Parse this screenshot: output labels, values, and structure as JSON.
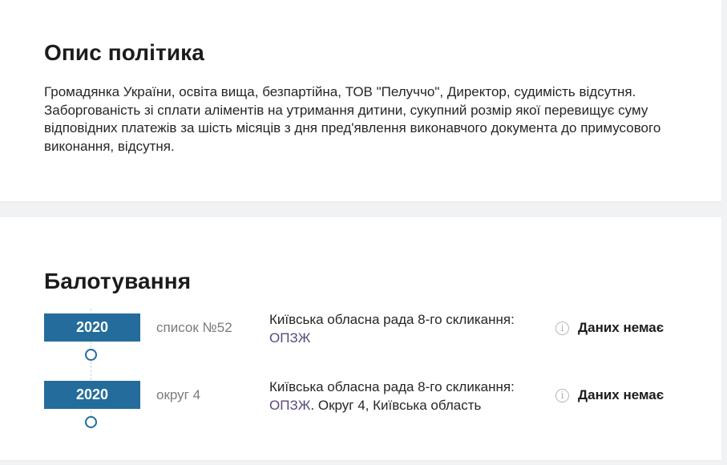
{
  "description": {
    "heading": "Опис політика",
    "text": "Громадянка України, освіта вища, безпартійна, ТОВ \"Пелуччо\", Директор, судимість відсутня. Заборгованість зі сплати аліментів на утримання дитини, сукупний розмір якої перевищує суму відповідних платежів за шість місяців з дня пред'явлення виконавчого документа до примусового виконання, відсутня."
  },
  "ballot": {
    "heading": "Балотування",
    "entries": [
      {
        "year": "2020",
        "list": "список №52",
        "council": "Київська обласна рада 8-го скликання:",
        "party": "ОПЗЖ",
        "suffix": "",
        "status": "Даних немає"
      },
      {
        "year": "2020",
        "list": "округ 4",
        "council": "Київська обласна рада 8-го скликання:",
        "party": "ОПЗЖ",
        "suffix": ". Округ 4, Київська область",
        "status": "Даних немає"
      }
    ]
  },
  "icons": {
    "info": "info-icon"
  },
  "colors": {
    "accent": "#236c9c",
    "party_link": "#5a4a7a"
  }
}
